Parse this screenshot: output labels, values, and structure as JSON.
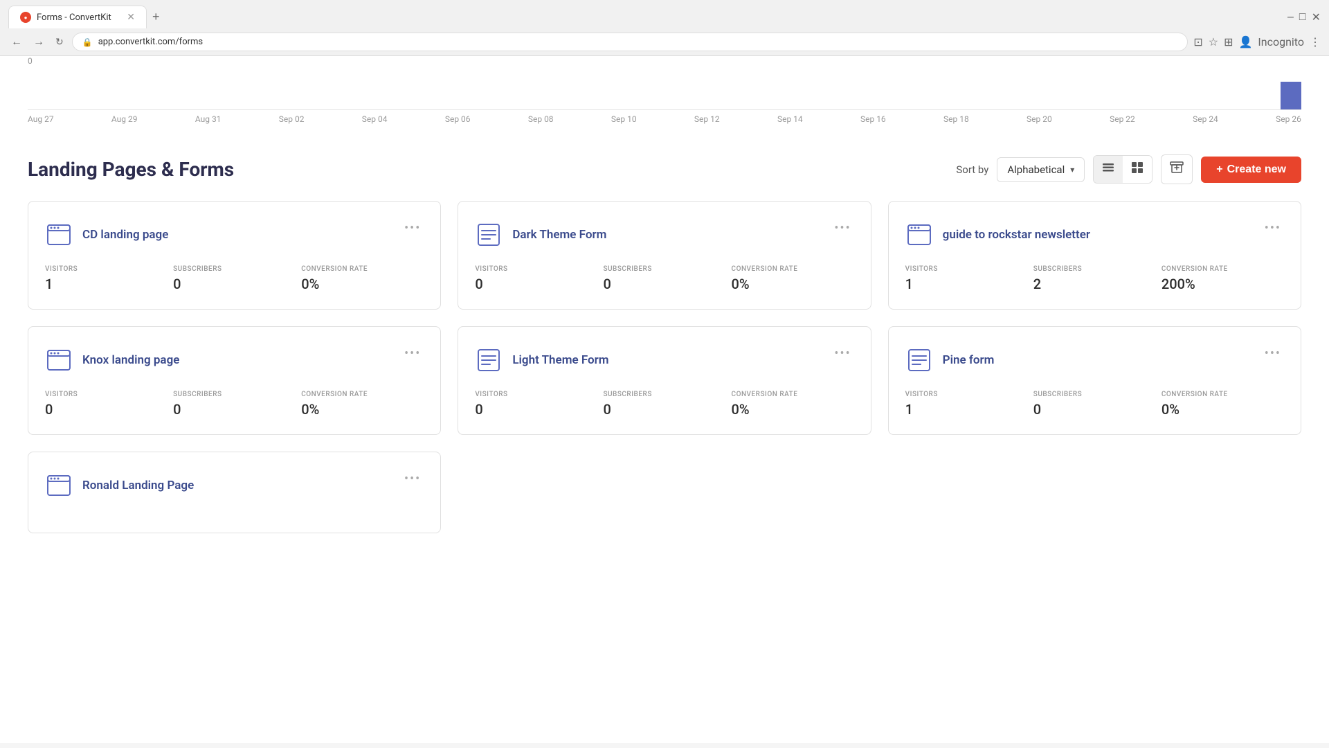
{
  "browser": {
    "tab_title": "Forms - ConvertKit",
    "tab_favicon": "CK",
    "url": "app.convertkit.com/forms",
    "url_display": "app.convertkit.com/forms",
    "incognito_label": "Incognito"
  },
  "chart": {
    "y_zero": "0",
    "x_labels": [
      "Aug 27",
      "Aug 29",
      "Aug 31",
      "Sep 02",
      "Sep 04",
      "Sep 06",
      "Sep 08",
      "Sep 10",
      "Sep 12",
      "Sep 14",
      "Sep 16",
      "Sep 18",
      "Sep 20",
      "Sep 22",
      "Sep 24",
      "Sep 26"
    ]
  },
  "section": {
    "title": "Landing Pages & Forms",
    "sort_label": "Sort by",
    "sort_value": "Alphabetical",
    "create_label": "Create new"
  },
  "cards": [
    {
      "id": "cd-landing-page",
      "name": "CD landing page",
      "type": "landing",
      "visitors_label": "VISITORS",
      "visitors": "1",
      "subscribers_label": "SUBSCRIBERS",
      "subscribers": "0",
      "conversion_label": "CONVERSION RATE",
      "conversion": "0%"
    },
    {
      "id": "dark-theme-form",
      "name": "Dark Theme Form",
      "type": "form",
      "visitors_label": "VISITORS",
      "visitors": "0",
      "subscribers_label": "SUBSCRIBERS",
      "subscribers": "0",
      "conversion_label": "CONVERSION RATE",
      "conversion": "0%"
    },
    {
      "id": "guide-to-rockstar",
      "name": "guide to rockstar newsletter",
      "type": "landing",
      "visitors_label": "VISITORS",
      "visitors": "1",
      "subscribers_label": "SUBSCRIBERS",
      "subscribers": "2",
      "conversion_label": "CONVERSION RATE",
      "conversion": "200%"
    },
    {
      "id": "knox-landing-page",
      "name": "Knox landing page",
      "type": "landing",
      "visitors_label": "VISITORS",
      "visitors": "0",
      "subscribers_label": "SUBSCRIBERS",
      "subscribers": "0",
      "conversion_label": "CONVERSION RATE",
      "conversion": "0%"
    },
    {
      "id": "light-theme-form",
      "name": "Light Theme Form",
      "type": "form",
      "visitors_label": "VISITORS",
      "visitors": "0",
      "subscribers_label": "SUBSCRIBERS",
      "subscribers": "0",
      "conversion_label": "CONVERSION RATE",
      "conversion": "0%"
    },
    {
      "id": "pine-form",
      "name": "Pine form",
      "type": "form",
      "visitors_label": "VISITORS",
      "visitors": "1",
      "subscribers_label": "SUBSCRIBERS",
      "subscribers": "0",
      "conversion_label": "CONVERSION RATE",
      "conversion": "0%"
    }
  ],
  "bottom_card": {
    "name": "Ronald Landing Page",
    "type": "landing"
  },
  "icons": {
    "menu": "•••",
    "list_view": "≡",
    "grid_view": "⊞",
    "archive": "🗂",
    "plus": "+"
  }
}
